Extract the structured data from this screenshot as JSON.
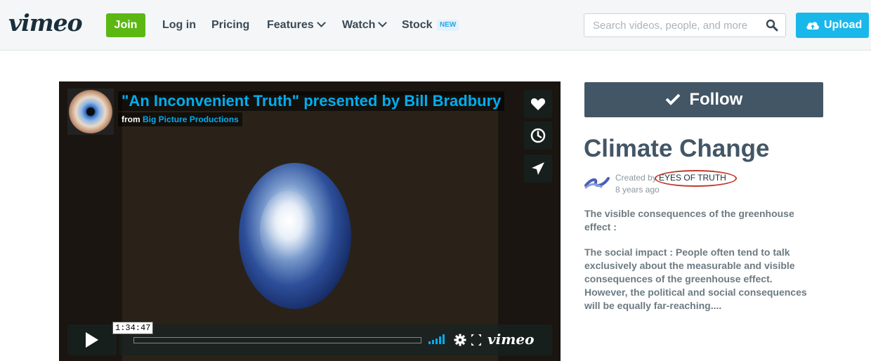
{
  "header": {
    "logo": "vimeo",
    "join_label": "Join",
    "nav": [
      "Log in",
      "Pricing",
      "Features",
      "Watch",
      "Stock"
    ],
    "stock_badge": "NEW",
    "search_placeholder": "Search videos, people, and more",
    "upload_label": "Upload"
  },
  "player": {
    "title": "\"An Inconvenient Truth\" presented by Bill Bradbury",
    "from_label": "from",
    "creator": "Big Picture Productions",
    "timecode": "1:34:47",
    "progress_fraction": 0.0,
    "logo": "vimeo",
    "icons": [
      "heart-icon",
      "clock-icon",
      "send-icon",
      "play-icon",
      "volume-icon",
      "gear-icon",
      "fullscreen-icon"
    ]
  },
  "channel": {
    "follow_label": "Follow",
    "title": "Climate Change",
    "created_by_label": "Created by",
    "creator_name": "EYES OF TRUTH",
    "age": "8 years ago",
    "desc_1": "The visible consequences of the greenhouse effect :",
    "desc_2": "The social impact : People often tend to talk exclusively about the measurable and visible consequences of the greenhouse effect. However, the political and social consequences will be equally far-reaching....",
    "annotation_color": "#c0392b"
  },
  "colors": {
    "join": "#5cb713",
    "upload": "#1ab7ea",
    "accent": "#00adef",
    "follow": "#435666"
  }
}
